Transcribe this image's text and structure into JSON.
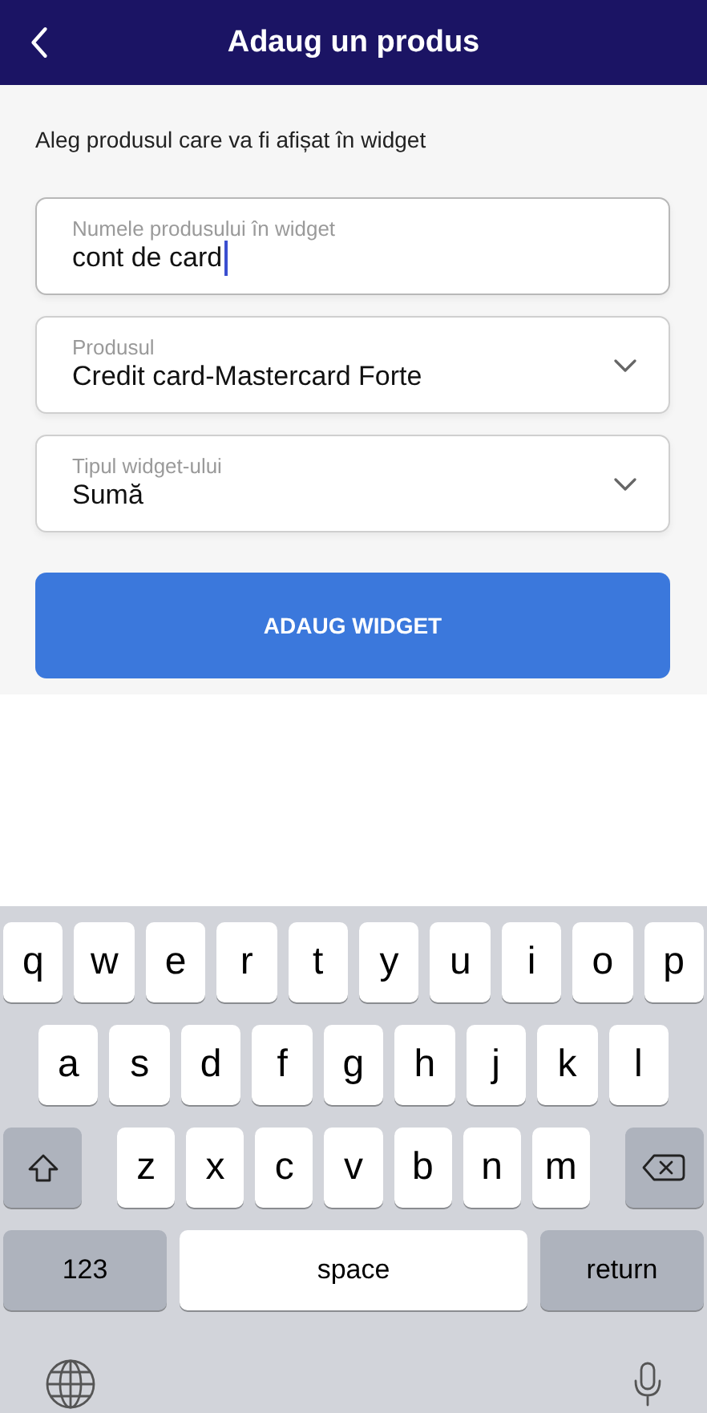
{
  "header": {
    "title": "Adaug un produs"
  },
  "subtitle": "Aleg produsul care va fi afișat în widget",
  "fields": [
    {
      "kind": "text",
      "label": "Numele produsului în widget",
      "value": "cont de card",
      "focused": true
    },
    {
      "kind": "select",
      "label": "Produsul",
      "value": "Credit card-Mastercard Forte",
      "focused": false
    },
    {
      "kind": "select",
      "label": "Tipul widget-ului",
      "value": "Sumă",
      "focused": false
    }
  ],
  "button": "ADAUG WIDGET",
  "keyboard": {
    "rows": [
      {
        "keys": [
          {
            "kind": "letter",
            "label": "q"
          },
          {
            "kind": "letter",
            "label": "w"
          },
          {
            "kind": "letter",
            "label": "e"
          },
          {
            "kind": "letter",
            "label": "r"
          },
          {
            "kind": "letter",
            "label": "t"
          },
          {
            "kind": "letter",
            "label": "y"
          },
          {
            "kind": "letter",
            "label": "u"
          },
          {
            "kind": "letter",
            "label": "i"
          },
          {
            "kind": "letter",
            "label": "o"
          },
          {
            "kind": "letter",
            "label": "p"
          }
        ]
      },
      {
        "keys": [
          {
            "kind": "letter",
            "label": "a"
          },
          {
            "kind": "letter",
            "label": "s"
          },
          {
            "kind": "letter",
            "label": "d"
          },
          {
            "kind": "letter",
            "label": "f"
          },
          {
            "kind": "letter",
            "label": "g"
          },
          {
            "kind": "letter",
            "label": "h"
          },
          {
            "kind": "letter",
            "label": "j"
          },
          {
            "kind": "letter",
            "label": "k"
          },
          {
            "kind": "letter",
            "label": "l"
          }
        ]
      },
      {
        "keys": [
          {
            "kind": "shift"
          },
          {
            "kind": "letter",
            "label": "z"
          },
          {
            "kind": "letter",
            "label": "x"
          },
          {
            "kind": "letter",
            "label": "c"
          },
          {
            "kind": "letter",
            "label": "v"
          },
          {
            "kind": "letter",
            "label": "b"
          },
          {
            "kind": "letter",
            "label": "n"
          },
          {
            "kind": "letter",
            "label": "m"
          },
          {
            "kind": "delete"
          }
        ]
      },
      {
        "keys": [
          {
            "kind": "mode",
            "label": "123"
          },
          {
            "kind": "space",
            "label": "space"
          },
          {
            "kind": "return",
            "label": "return"
          }
        ]
      },
      {
        "keys": [
          {
            "kind": "globe"
          },
          {
            "kind": "mic"
          }
        ]
      }
    ]
  }
}
